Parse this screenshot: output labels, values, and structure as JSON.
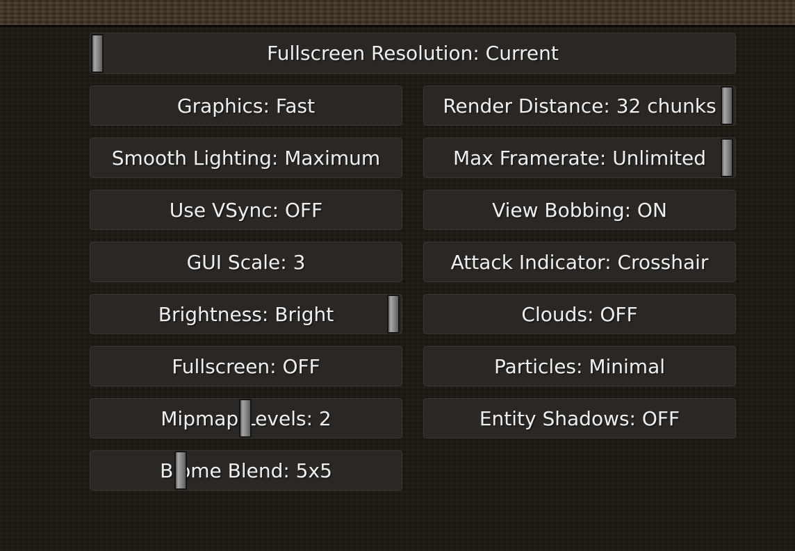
{
  "options": {
    "fullscreen_resolution": "Fullscreen Resolution: Current",
    "graphics": "Graphics: Fast",
    "render_distance": "Render Distance: 32 chunks",
    "smooth_lighting": "Smooth Lighting: Maximum",
    "max_framerate": "Max Framerate: Unlimited",
    "use_vsync": "Use VSync: OFF",
    "view_bobbing": "View Bobbing: ON",
    "gui_scale": "GUI Scale: 3",
    "attack_indicator": "Attack Indicator: Crosshair",
    "brightness": "Brightness: Bright",
    "clouds": "Clouds: OFF",
    "fullscreen": "Fullscreen: OFF",
    "particles": "Particles: Minimal",
    "mipmap_levels": "Mipmap Levels: 2",
    "entity_shadows": "Entity Shadows: OFF",
    "biome_blend": "Biome Blend: 5x5"
  },
  "slider_levels": {
    "fullscreen_resolution": 0.0,
    "render_distance": 1.0,
    "max_framerate": 1.0,
    "brightness": 1.0,
    "mipmap_levels": 0.5,
    "biome_blend": 0.3
  },
  "colors": {
    "button_bg": "#2a2724",
    "button_text": "#eeeeee",
    "background": "#1c1711",
    "top_band": "#3d2f22"
  }
}
